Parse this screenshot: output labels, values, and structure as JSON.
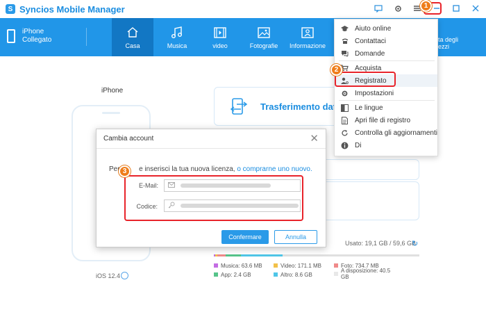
{
  "app": {
    "title": "Syncios Mobile Manager"
  },
  "device": {
    "name": "iPhone",
    "status": "Collegato"
  },
  "nav": [
    {
      "label": "Casa",
      "icon": "home-icon",
      "active": true
    },
    {
      "label": "Musica",
      "icon": "music-icon"
    },
    {
      "label": "video",
      "icon": "video-icon"
    },
    {
      "label": "Fotografie",
      "icon": "photo-icon"
    },
    {
      "label": "Informazione",
      "icon": "info-card-icon"
    }
  ],
  "nav_partial_label": "ta degli\nezzi",
  "home": {
    "phone_label": "iPhone",
    "ios_version": "iOS 12.4",
    "transfer_label": "Trasferimento dati",
    "usage": "Usato: 19,1 GB / 59,6 GB",
    "storage": [
      {
        "label": "Musica: 63.6 MB",
        "color": "#c46de3"
      },
      {
        "label": "Video: 171.1 MB",
        "color": "#f2c14a"
      },
      {
        "label": "Foto: 734.7 MB",
        "color": "#f08a8a"
      },
      {
        "label": "App: 2.4 GB",
        "color": "#56c48a"
      },
      {
        "label": "Altro: 8.6 GB",
        "color": "#4fc6e8"
      },
      {
        "label": "A disposizione: 40.5\nGB",
        "color": "#e8e8e8"
      }
    ]
  },
  "menu": {
    "items": [
      {
        "label": "Aiuto online",
        "icon": "graduation-cap-icon"
      },
      {
        "label": "Contattaci",
        "icon": "phone-icon"
      },
      {
        "label": "Domande",
        "icon": "chat-icon"
      },
      {
        "label": "Acquista",
        "icon": "cart-icon"
      },
      {
        "label": "Registrato",
        "icon": "key-user-icon"
      },
      {
        "label": "Impostazioni",
        "icon": "gear-icon"
      },
      {
        "label": "Le lingue",
        "icon": "language-icon"
      },
      {
        "label": "Apri file di registro",
        "icon": "document-icon"
      },
      {
        "label": "Controlla gli aggiornamenti",
        "icon": "refresh-icon"
      },
      {
        "label": "Di",
        "icon": "info-icon"
      }
    ]
  },
  "dialog": {
    "title": "Cambia account",
    "message_prefix": "Per f",
    "message_middle": "e inserisci la tua nuova licenza, ",
    "message_link": "o comprarne uno nuovo.",
    "email_label": "E-Mail:",
    "code_label": "Codice:",
    "confirm_label": "Confermare",
    "cancel_label": "Annulla"
  },
  "annotations": [
    "1",
    "2",
    "3"
  ]
}
